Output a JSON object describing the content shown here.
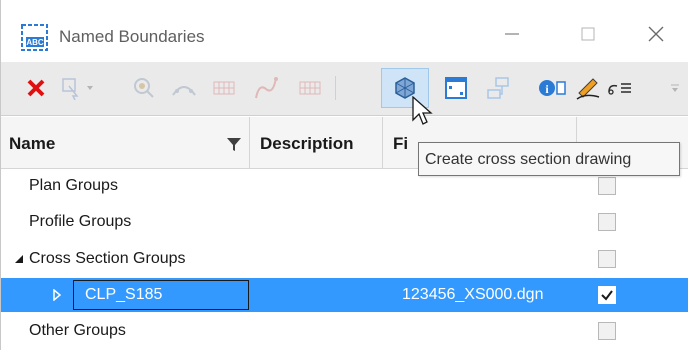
{
  "window": {
    "title": "Named Boundaries",
    "app_icon_text": "ABC",
    "controls": [
      "minimize",
      "maximize",
      "close"
    ]
  },
  "toolbar": {
    "buttons": [
      {
        "name": "delete",
        "icon": "red-x-icon",
        "enabled": true
      },
      {
        "name": "select-dropdown",
        "icon": "select-icon",
        "enabled": false
      },
      {
        "name": "zoom",
        "icon": "zoom-icon",
        "enabled": false
      },
      {
        "name": "group",
        "icon": "group-icon",
        "enabled": false
      },
      {
        "name": "grid",
        "icon": "grid-icon",
        "enabled": false
      },
      {
        "name": "profile",
        "icon": "curve-icon",
        "enabled": false
      },
      {
        "name": "grid-2",
        "icon": "grid-icon",
        "enabled": false
      },
      {
        "name": "create-cross-section-drawing",
        "icon": "cube-icon",
        "enabled": true,
        "active": true
      },
      {
        "name": "fit-view",
        "icon": "frame-icon",
        "enabled": true
      },
      {
        "name": "hierarchy",
        "icon": "hierarchy-icon",
        "enabled": false
      },
      {
        "name": "properties",
        "icon": "info-icon",
        "enabled": true
      },
      {
        "name": "pen",
        "icon": "pen-icon",
        "enabled": true
      },
      {
        "name": "settings",
        "icon": "list-icon",
        "enabled": true
      }
    ]
  },
  "tooltip": {
    "text": "Create cross section drawing"
  },
  "table": {
    "columns": {
      "name": "Name",
      "description": "Description",
      "file": "Fi"
    },
    "rows": [
      {
        "label": "Plan Groups",
        "file": "",
        "checked": false,
        "level": 1,
        "expander": "",
        "selected": false
      },
      {
        "label": "Profile Groups",
        "file": "",
        "checked": false,
        "level": 1,
        "expander": "",
        "selected": false
      },
      {
        "label": "Cross Section Groups",
        "file": "",
        "checked": false,
        "level": 1,
        "expander": "▲",
        "selected": false
      },
      {
        "label": "CLP_S185",
        "file": "123456_XS000.dgn",
        "checked": true,
        "level": 2,
        "expander": "▶",
        "selected": true
      },
      {
        "label": "Other Groups",
        "file": "",
        "checked": false,
        "level": 1,
        "expander": "",
        "selected": false
      }
    ]
  },
  "colors": {
    "selection": "#3399ff",
    "active_button": "#cfe5f7",
    "delete_red": "#e01010"
  }
}
